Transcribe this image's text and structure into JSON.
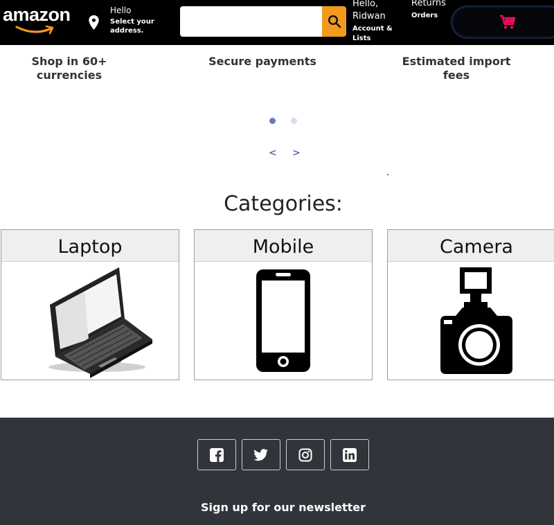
{
  "header": {
    "logo_text": "amazon",
    "deliver_hello": "Hello",
    "deliver_address": "Select your address.",
    "search_placeholder": "",
    "account_greeting": "Hello, Ridwan",
    "account_sub": "Account & Lists",
    "returns_line1": "Returns",
    "returns_line2": "Orders",
    "cart_icon": "cart-icon"
  },
  "features": [
    {
      "label": "Shop in 60+ currencies"
    },
    {
      "label": "Secure payments"
    },
    {
      "label": "Estimated import fees"
    }
  ],
  "carousel": {
    "prev": "<",
    "next": ">",
    "active_index": 0,
    "slide_count": 2
  },
  "categories": {
    "title": "Categories:",
    "items": [
      {
        "name": "Laptop",
        "icon": "laptop-icon"
      },
      {
        "name": "Mobile",
        "icon": "mobile-phone-icon"
      },
      {
        "name": "Camera",
        "icon": "camera-icon"
      }
    ]
  },
  "footer": {
    "social": [
      "facebook-icon",
      "twitter-icon",
      "instagram-icon",
      "linkedin-icon"
    ],
    "newsletter": "Sign up for our newsletter"
  },
  "colors": {
    "navbar": "#000000",
    "search_button": "#f29a1e",
    "cart": "#e8105a",
    "footer": "#32343b",
    "dot_active": "#6a7ac0",
    "dot_inactive": "#d6dbf0"
  }
}
